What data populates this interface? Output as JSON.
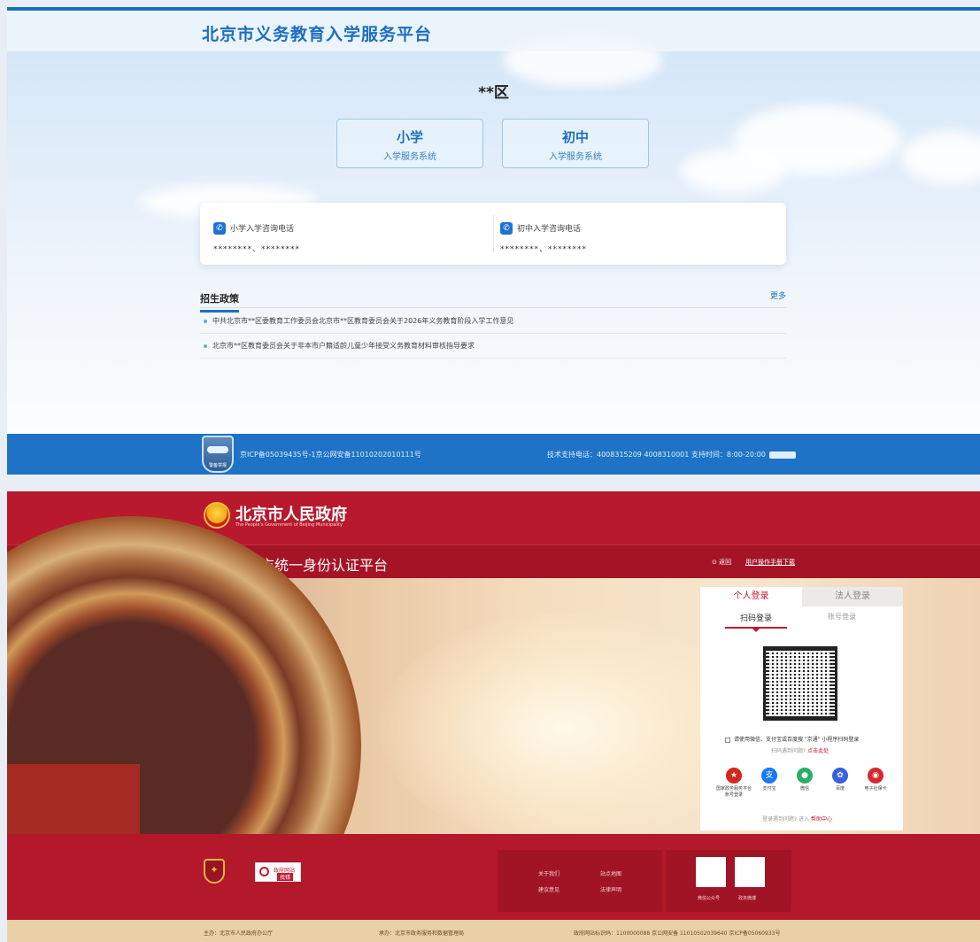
{
  "enrollment_site": {
    "title": "北京市义务教育入学服务平台",
    "district": "**区",
    "cards": [
      {
        "title": "小学",
        "subtitle": "入学服务系统"
      },
      {
        "title": "初中",
        "subtitle": "入学服务系统"
      }
    ],
    "phones": [
      {
        "label": "小学入学咨询电话",
        "numbers": "********、********"
      },
      {
        "label": "初中入学咨询电话",
        "numbers": "********、********"
      }
    ],
    "policy": {
      "title": "招生政策",
      "more": "更多",
      "items": [
        "中共北京市**区委教育工作委员会北京市**区教育委员会关于2026年义务教育阶段入学工作意见",
        "北京市**区教育委员会关于非本市户籍适龄儿童少年接受义务教育材料审核指导要求"
      ]
    },
    "footer": {
      "badge_text": "警备举报",
      "icp": "京ICP备05039435号-1京公网安备11010202010111号",
      "support": "技术支持电话：4008315209 4008310001 支持时间：8:00-20:00"
    },
    "colors": {
      "primary": "#1c6fc0",
      "footer": "#1e73c6"
    }
  },
  "auth_site": {
    "gov_name": "北京市人民政府",
    "gov_name_en": "The People's Government of Beijing Municipality",
    "platform_title": "北京市统一身份认证平台",
    "back": "返回",
    "manual": "用户操作手册下载",
    "login": {
      "tab_personal": "个人登录",
      "tab_legal": "法人登录",
      "sub_scan": "扫码登录",
      "sub_account": "账号登录",
      "scan_tip": "请使用微信、支付宝或百度搜 \"京通\" 小程序扫码登录",
      "scan_help_prefix": "扫码遇到问题?",
      "scan_help_link": "点击此处",
      "methods": [
        {
          "icon": "national-gov-service-icon",
          "label": "国家政务服务平台账号登录",
          "color": "#d6261f"
        },
        {
          "icon": "alipay-icon",
          "label": "支付宝",
          "color": "#1678ff"
        },
        {
          "icon": "wechat-icon",
          "label": "微信",
          "color": "#2aae67"
        },
        {
          "icon": "baidu-icon",
          "label": "百度",
          "color": "#3a5fe0"
        },
        {
          "icon": "social-security-card-icon",
          "label": "电子社保卡",
          "color": "#d8262f"
        }
      ],
      "help_prefix": "登录遇到问题? 进入",
      "help_link": "帮助中心"
    },
    "footer": {
      "find_error_1": "政府网站",
      "find_error_2": "找错",
      "links": [
        "关于我们",
        "站点地图",
        "建议意见",
        "法律声明"
      ],
      "qr_labels": [
        "微信公众号",
        "政务微博"
      ]
    },
    "bottom": {
      "sponsor": "主办：北京市人民政府办公厅",
      "organizer": "承办：北京市政务服务和数据管理局",
      "site_id": "政府网站标识码：1100000088 京公网安备 11010502039640 京ICP备05060933号"
    },
    "colors": {
      "brand_red": "#b8192d",
      "accent": "#c21a30"
    }
  }
}
